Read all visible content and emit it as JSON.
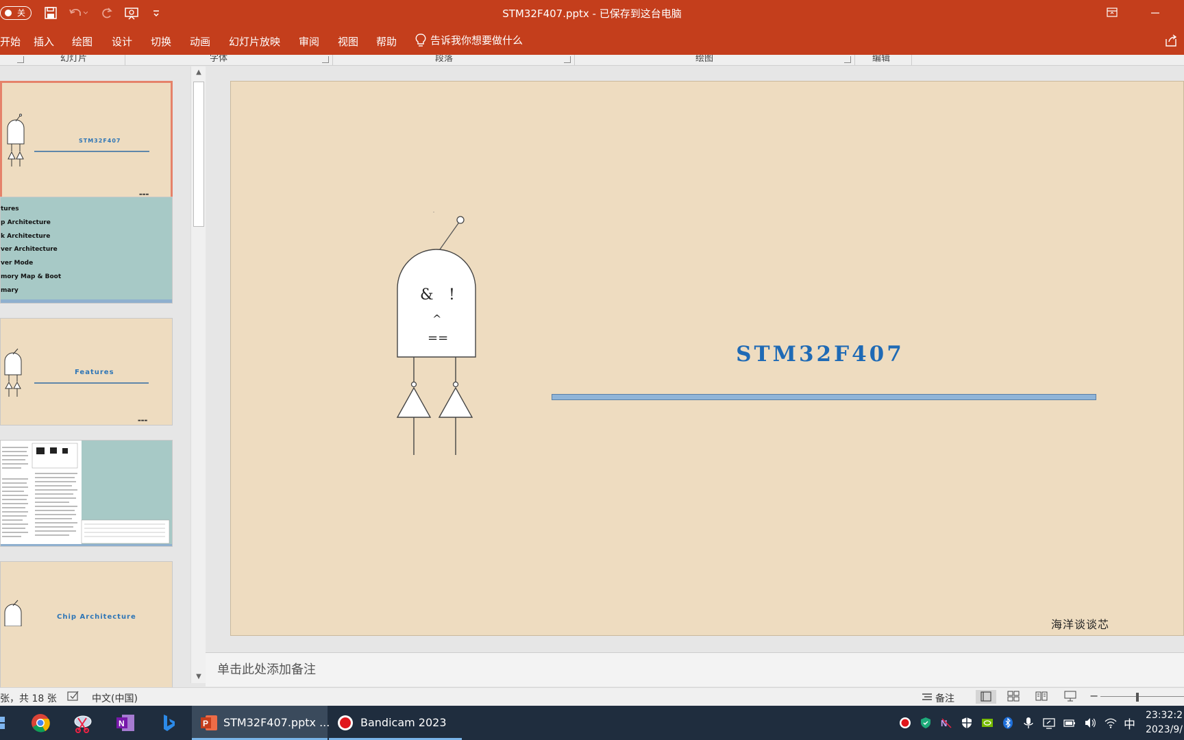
{
  "titlebar": {
    "autosave_label": "关",
    "doc_title": "STM32F407.pptx - 已保存到这台电脑"
  },
  "ribbon": {
    "tabs": [
      "开始",
      "插入",
      "绘图",
      "设计",
      "切换",
      "动画",
      "幻灯片放映",
      "审阅",
      "视图",
      "帮助"
    ],
    "tell_me": "告诉我你想要做什么"
  },
  "groups": [
    "幻灯片",
    "字体",
    "段落",
    "绘图",
    "编辑"
  ],
  "thumbnails": {
    "slide1_title": "STM32F407",
    "slide2_items": [
      "tures",
      "p Architecture",
      "k Architecture",
      "ver Architecture",
      "ver Mode",
      "mory Map & Boot",
      "mary"
    ],
    "slide3_title": "Features",
    "slide5_title": "Chip Architecture"
  },
  "slide": {
    "gate_symbols": [
      "&",
      "!",
      "^",
      "=="
    ],
    "title": "STM32F407",
    "footer": "海洋谈谈芯"
  },
  "notes": {
    "placeholder": "单击此处添加备注"
  },
  "status": {
    "slide_count": "张，共 18 张",
    "language": "中文(中国)",
    "notes_label": "备注"
  },
  "taskbar": {
    "apps": [
      {
        "label": "STM32F407.pptx ..."
      },
      {
        "label": "Bandicam 2023"
      }
    ],
    "ime": "中",
    "time": "23:32:2",
    "date": "2023/9/"
  },
  "colors": {
    "accent": "#c43e1c",
    "slide_bg": "#eedcc0",
    "title_blue": "#1f6ab5"
  }
}
